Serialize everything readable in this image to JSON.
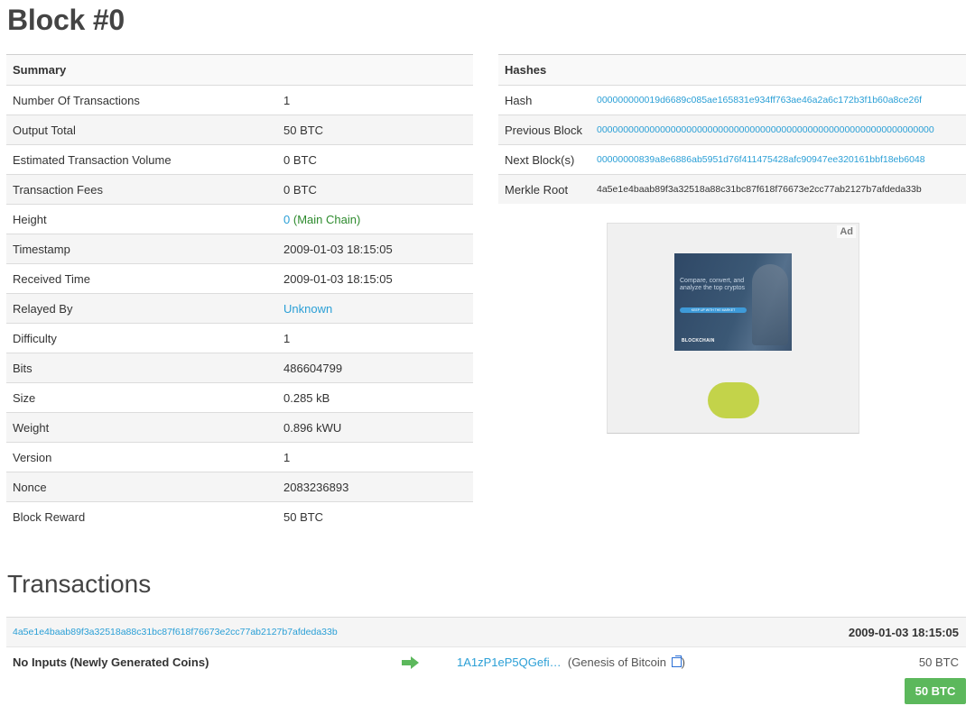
{
  "page_title": "Block #0",
  "summary": {
    "heading": "Summary",
    "rows": [
      {
        "label": "Number Of Transactions",
        "value": "1"
      },
      {
        "label": "Output Total",
        "value": "50 BTC"
      },
      {
        "label": "Estimated Transaction Volume",
        "value": "0 BTC"
      },
      {
        "label": "Transaction Fees",
        "value": "0 BTC"
      },
      {
        "label": "Height",
        "value": "0",
        "suffix": "(Main Chain)"
      },
      {
        "label": "Timestamp",
        "value": "2009-01-03 18:15:05"
      },
      {
        "label": "Received Time",
        "value": "2009-01-03 18:15:05"
      },
      {
        "label": "Relayed By",
        "value": "Unknown"
      },
      {
        "label": "Difficulty",
        "value": "1"
      },
      {
        "label": "Bits",
        "value": "486604799"
      },
      {
        "label": "Size",
        "value": "0.285 kB"
      },
      {
        "label": "Weight",
        "value": "0.896 kWU"
      },
      {
        "label": "Version",
        "value": "1"
      },
      {
        "label": "Nonce",
        "value": "2083236893"
      },
      {
        "label": "Block Reward",
        "value": "50 BTC"
      }
    ]
  },
  "hashes": {
    "heading": "Hashes",
    "rows": [
      {
        "label": "Hash",
        "value": "000000000019d6689c085ae165831e934ff763ae46a2a6c172b3f1b60a8ce26f"
      },
      {
        "label": "Previous Block",
        "value": "0000000000000000000000000000000000000000000000000000000000000000"
      },
      {
        "label": "Next Block(s)",
        "value": "00000000839a8e6886ab5951d76f411475428afc90947ee320161bbf18eb6048"
      },
      {
        "label": "Merkle Root",
        "value": "4a5e1e4baab89f3a32518a88c31bc87f618f76673e2cc77ab2127b7afdeda33b"
      }
    ]
  },
  "ad": {
    "label": "Ad",
    "text": "Compare, convert, and analyze the top cryptos",
    "button": "KEEP UP WITH THE MARKET",
    "logo": "BLOCKCHAIN"
  },
  "transactions": {
    "heading": "Transactions",
    "items": [
      {
        "hash": "4a5e1e4baab89f3a32518a88c31bc87f618f76673e2cc77ab2127b7afdeda33b",
        "time": "2009-01-03 18:15:05",
        "inputs": "No Inputs (Newly Generated Coins)",
        "output_address": "1A1zP1eP5QGefi…",
        "output_note": "(Genesis of Bitcoin",
        "output_note_close": ")",
        "output_amount": "50 BTC",
        "total": "50 BTC"
      }
    ]
  },
  "colors": {
    "link": "#2a9fd6",
    "accent_green": "#5cb85c",
    "main_chain": "#2e8b2e"
  }
}
